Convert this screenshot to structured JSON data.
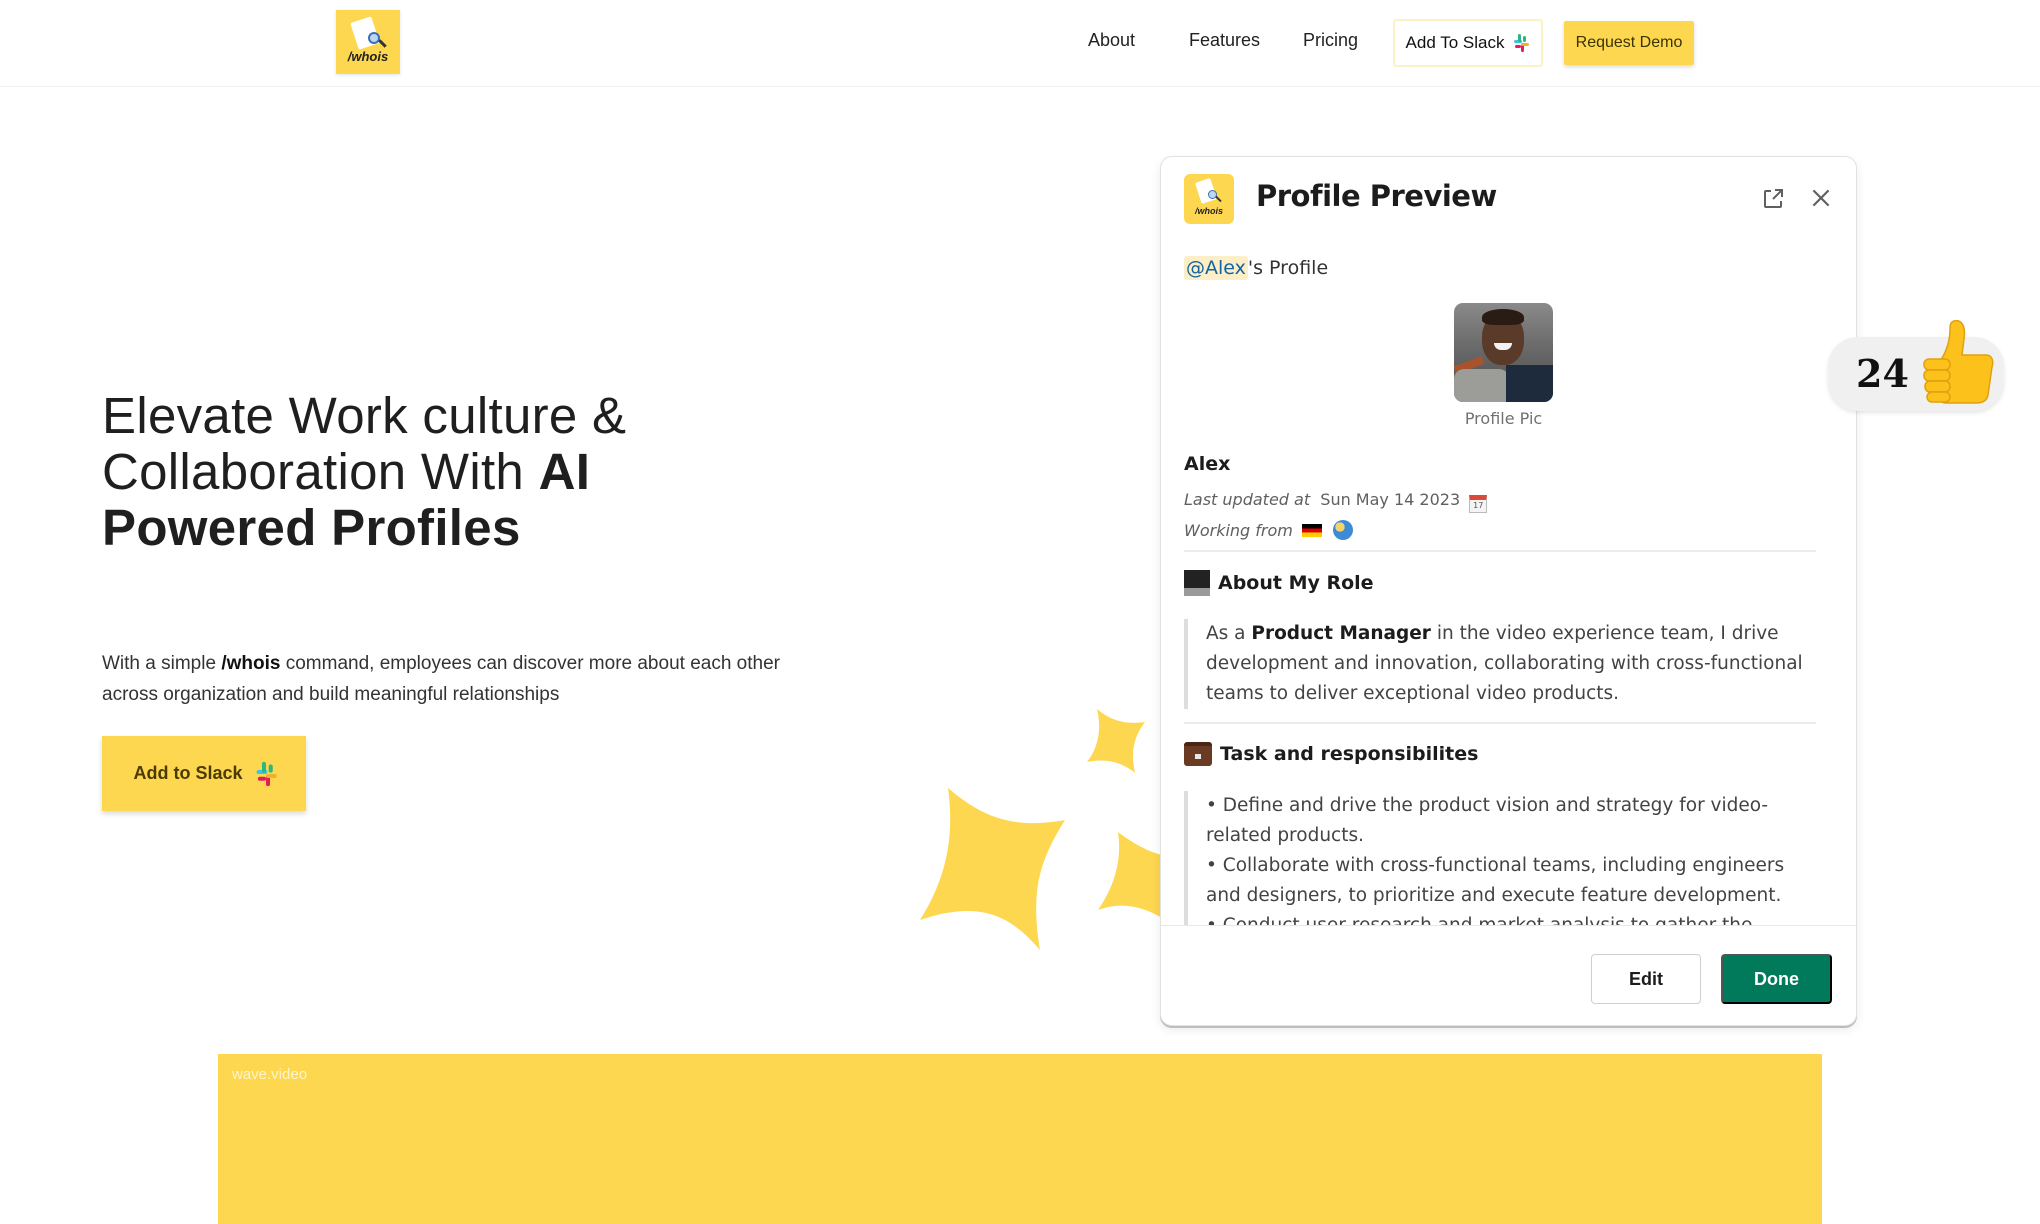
{
  "nav": {
    "logo_text": "/whois",
    "links": [
      "About",
      "Features",
      "Pricing"
    ],
    "add_to_slack": "Add To Slack",
    "request_demo": "Request Demo"
  },
  "hero": {
    "title_regular_1": "Elevate Work culture &",
    "title_regular_2": "Collaboration With ",
    "title_bold_1": "AI",
    "title_bold_2": "Powered Profiles",
    "desc_prefix": "With a simple ",
    "desc_command": "/whois",
    "desc_suffix": " command, employees can discover more about each other across organization and build meaningful relationships",
    "cta_label": "Add to Slack"
  },
  "modal": {
    "logo_text": "/whois",
    "title": "Profile Preview",
    "mention": "@Alex",
    "mention_suffix": "'s Profile",
    "pic_caption": "Profile Pic",
    "name": "Alex",
    "updated_label": "Last updated at",
    "updated_value": "Sun May 14 2023",
    "working_label": "Working from",
    "role_heading": "About My Role",
    "role_prefix": "As a ",
    "role_title": "Product Manager",
    "role_suffix": " in the video experience team, I drive development and innovation, collaborating with cross-functional teams to deliver exceptional video products.",
    "task_heading": "Task and responsibilites",
    "tasks": [
      "• Define and drive the product vision and strategy for video-related products.",
      "• Collaborate with cross-functional teams, including engineers and designers, to prioritize and execute feature development.",
      "• Conduct user research and market analysis to gather the feedback and insights."
    ],
    "edit_label": "Edit",
    "done_label": "Done"
  },
  "reaction": {
    "count": "24",
    "emoji": "thumbs-up"
  },
  "video": {
    "label": "wave.video"
  },
  "colors": {
    "brand_yellow": "#fdd74f",
    "done_green": "#007a5a",
    "mention_bg": "#fcefc7",
    "mention_text": "#1264a3"
  }
}
